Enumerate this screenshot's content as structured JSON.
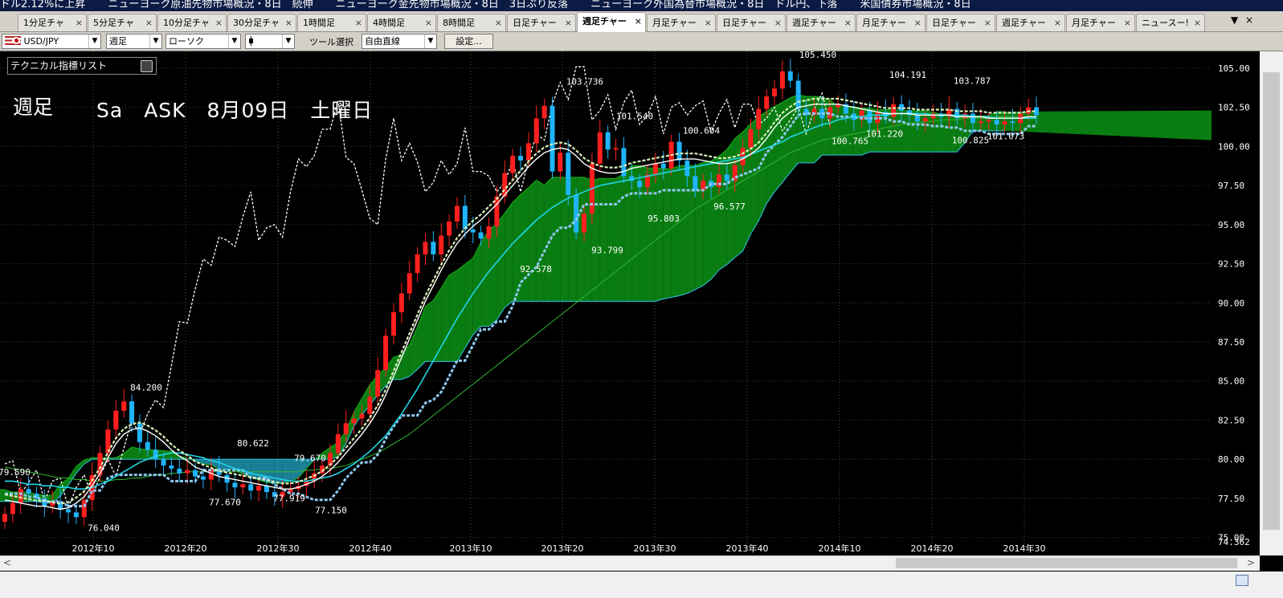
{
  "ticker": [
    "ドル2.12%に上昇",
    "ニューヨーク原油先物市場概況・8日　続伸",
    "ニューヨーク金先物市場概況・8日　3日ぶり反落",
    "ニューヨーク外国為替市場概況・8日　ドル円、下落",
    "米国債券市場概況・8日"
  ],
  "tabs": [
    {
      "label": "1分足チャ"
    },
    {
      "label": "5分足チャ"
    },
    {
      "label": "10分足チャ"
    },
    {
      "label": "30分足チャ"
    },
    {
      "label": "1時間足"
    },
    {
      "label": "4時間足"
    },
    {
      "label": "8時間足"
    },
    {
      "label": "日足チャー"
    },
    {
      "label": "週足チャー",
      "active": true
    },
    {
      "label": "月足チャー"
    },
    {
      "label": "日足チャー"
    },
    {
      "label": "週足チャー"
    },
    {
      "label": "月足チャー"
    },
    {
      "label": "日足チャー"
    },
    {
      "label": "週足チャー"
    },
    {
      "label": "月足チャー"
    },
    {
      "label": "ニュースー!"
    }
  ],
  "tab_close_glyph": "×",
  "toolbar": {
    "symbol": "USD/JPY",
    "period": "週足",
    "chart_type": "ローソク",
    "line_style": "",
    "tool_label": "ツール選択",
    "tool_value": "自由直線",
    "settings_button": "設定..."
  },
  "indicator_list": "テクニカル指標リスト",
  "title": "週足",
  "subtitle": "Sa　ASK　8月09日　土曜日",
  "chart_data": {
    "type": "candlestick",
    "y_ticks": [
      "105.00",
      "102.50",
      "100.00",
      "97.50",
      "95.00",
      "92.50",
      "90.00",
      "87.50",
      "85.00",
      "82.50",
      "80.00",
      "77.50",
      "75.00"
    ],
    "y_min_label": "74.362",
    "ylim": [
      74.362,
      106.5
    ],
    "x_ticks": [
      "2012年10",
      "2012年20",
      "2012年30",
      "2012年40",
      "2013年10",
      "2013年20",
      "2013年30",
      "2013年40",
      "2014年10",
      "2014年20",
      "2014年30"
    ],
    "annotations": [
      {
        "text": "84.200",
        "value": 84.2
      },
      {
        "text": "79.590",
        "value": 79.59
      },
      {
        "text": "76.040",
        "value": 76.04
      },
      {
        "text": "80.622",
        "value": 80.622
      },
      {
        "text": "77.670",
        "value": 77.67
      },
      {
        "text": "79.670",
        "value": 79.67
      },
      {
        "text": "77.919",
        "value": 77.919
      },
      {
        "text": "77.150",
        "value": 77.15
      },
      {
        "text": "92.578",
        "value": 92.578
      },
      {
        "text": "103.736",
        "value": 103.736
      },
      {
        "text": "93.799",
        "value": 93.799
      },
      {
        "text": "101.540",
        "value": 101.54
      },
      {
        "text": "95.803",
        "value": 95.803
      },
      {
        "text": "100.604",
        "value": 100.604
      },
      {
        "text": "96.577",
        "value": 96.577
      },
      {
        "text": "105.450",
        "value": 105.45
      },
      {
        "text": "104.191",
        "value": 104.191
      },
      {
        "text": "100.765",
        "value": 100.765
      },
      {
        "text": "101.220",
        "value": 101.22
      },
      {
        "text": "100.825",
        "value": 100.825
      },
      {
        "text": "101.073",
        "value": 101.073
      },
      {
        "text": "103.787",
        "value": 103.787
      }
    ],
    "closes": [
      76.5,
      77.2,
      78.1,
      77.8,
      77.5,
      77.0,
      77.3,
      76.8,
      76.6,
      76.3,
      77.4,
      79.0,
      80.4,
      81.9,
      83.1,
      83.7,
      82.3,
      81.1,
      80.6,
      80.0,
      79.6,
      79.4,
      79.1,
      79.3,
      78.9,
      78.7,
      79.4,
      79.0,
      78.5,
      78.2,
      78.4,
      78.0,
      78.3,
      77.9,
      77.6,
      77.9,
      78.1,
      78.3,
      78.6,
      79.1,
      79.6,
      80.4,
      81.6,
      82.3,
      82.6,
      82.9,
      84.0,
      85.7,
      87.9,
      89.4,
      90.6,
      91.9,
      93.1,
      93.9,
      93.1,
      94.3,
      95.2,
      96.2,
      94.7,
      94.5,
      94.1,
      94.9,
      96.8,
      98.3,
      99.4,
      99.1,
      100.2,
      101.8,
      102.6,
      98.4,
      99.6,
      96.9,
      94.5,
      95.7,
      98.9,
      100.9,
      99.8,
      99.9,
      98.1,
      97.8,
      97.4,
      98.2,
      98.9,
      98.6,
      100.3,
      99.1,
      98.1,
      97.2,
      97.8,
      97.4,
      98.2,
      97.8,
      98.8,
      99.9,
      101.1,
      102.4,
      103.2,
      103.7,
      104.8,
      104.2,
      102.4,
      102.0,
      102.4,
      101.8,
      102.5,
      102.7,
      102.1,
      101.7,
      102.3,
      101.5,
      102.2,
      101.9,
      102.7,
      102.3,
      102.0,
      101.6,
      101.8,
      102.1,
      101.9,
      102.4,
      101.8,
      102.1,
      101.5,
      101.6,
      101.7,
      101.4,
      101.6,
      101.5,
      102.1,
      102.5,
      102.0
    ],
    "ma_fast": [
      77.4,
      77.3,
      77.2,
      77.1,
      77.0,
      77.0,
      76.9,
      76.8,
      76.9,
      77.2,
      77.6,
      78.3,
      79.1,
      80.1,
      81.0,
      81.6,
      81.9,
      82.0,
      81.8,
      81.5,
      81.1,
      80.6,
      80.2,
      79.9,
      79.5,
      79.3,
      79.1,
      78.9,
      78.8,
      78.7,
      78.6,
      78.5,
      78.4,
      78.3,
      78.2,
      78.1,
      78.1,
      78.2,
      78.4,
      78.6,
      78.9,
      79.3,
      79.8,
      80.4,
      81.0,
      81.6,
      82.3,
      83.1,
      84.1,
      85.3,
      86.5,
      87.7,
      88.9,
      90.1,
      91.1,
      92.1,
      93.0,
      93.8,
      94.4,
      94.9,
      95.3,
      95.8,
      96.3,
      96.9,
      97.5,
      98.1,
      98.7,
      99.2,
      99.6,
      99.8,
      99.9,
      99.8,
      99.4,
      98.9,
      98.6,
      98.4,
      98.3,
      98.3,
      98.4,
      98.6,
      98.7,
      98.8,
      98.9,
      99.0,
      99.1,
      99.2,
      99.2,
      99.2,
      99.1,
      99.0,
      98.9,
      98.9,
      99.0,
      99.2,
      99.5,
      99.9,
      100.5,
      101.2,
      101.8,
      102.2,
      102.5,
      102.6,
      102.7,
      102.7,
      102.7,
      102.7,
      102.6,
      102.5,
      102.4,
      102.3,
      102.2,
      102.1,
      102.1,
      102.1,
      102.1,
      102.0,
      102.0,
      102.0,
      102.0,
      102.0,
      101.9,
      101.9,
      101.9,
      101.9,
      101.8,
      101.8,
      101.8,
      101.8,
      101.8,
      101.9,
      101.9
    ],
    "ma_mid": [
      78.6,
      78.6,
      78.5,
      78.4,
      78.4,
      78.3,
      78.3,
      78.2,
      78.2,
      78.1,
      78.1,
      78.2,
      78.4,
      78.6,
      78.9,
      79.2,
      79.5,
      79.8,
      80.0,
      80.2,
      80.3,
      80.4,
      80.4,
      80.3,
      80.2,
      80.1,
      79.9,
      79.8,
      79.6,
      79.4,
      79.3,
      79.1,
      79.0,
      78.9,
      78.8,
      78.7,
      78.6,
      78.6,
      78.6,
      78.7,
      78.8,
      78.9,
      79.1,
      79.4,
      79.7,
      80.1,
      80.5,
      81.0,
      81.5,
      82.2,
      82.9,
      83.7,
      84.5,
      85.4,
      86.3,
      87.2,
      88.1,
      89.0,
      89.8,
      90.6,
      91.3,
      92.0,
      92.6,
      93.2,
      93.8,
      94.3,
      94.8,
      95.3,
      95.7,
      96.1,
      96.4,
      96.7,
      96.9,
      97.1,
      97.3,
      97.5,
      97.6,
      97.7,
      97.8,
      97.9,
      98.0,
      98.1,
      98.2,
      98.3,
      98.4,
      98.5,
      98.6,
      98.7,
      98.8,
      98.9,
      99.0,
      99.1,
      99.2,
      99.3,
      99.5,
      99.7,
      99.9,
      100.1,
      100.3,
      100.6,
      100.8,
      101.0,
      101.2,
      101.4,
      101.5,
      101.7,
      101.8,
      101.9,
      101.9,
      102.0,
      102.0,
      102.0,
      102.1,
      102.1,
      102.1,
      102.1,
      102.1,
      102.0,
      102.0,
      102.0,
      102.0,
      102.0,
      101.9,
      101.9,
      101.9,
      101.8,
      101.8,
      101.8,
      101.8,
      101.8,
      101.8
    ],
    "ma_slow": [
      79.5,
      79.4,
      79.3,
      79.2,
      79.1,
      79.0,
      78.9,
      78.8,
      78.8,
      78.7,
      78.7,
      78.6,
      78.6,
      78.6,
      78.7,
      78.7,
      78.8,
      78.8,
      78.9,
      79.0,
      79.0,
      79.1,
      79.1,
      79.2,
      79.2,
      79.2,
      79.2,
      79.2,
      79.2,
      79.2,
      79.2,
      79.2,
      79.2,
      79.2,
      79.2,
      79.2,
      79.2,
      79.2,
      79.3,
      79.3,
      79.4,
      79.4,
      79.5,
      79.6,
      79.8,
      80.0,
      80.2,
      80.4,
      80.7,
      81.0,
      81.3,
      81.6,
      82.0,
      82.4,
      82.8,
      83.2,
      83.6,
      84.0,
      84.4,
      84.8,
      85.2,
      85.6,
      86.0,
      86.4,
      86.8,
      87.2,
      87.6,
      88.0,
      88.4,
      88.8,
      89.2,
      89.6,
      90.0,
      90.4,
      90.8,
      91.2,
      91.6,
      92.0,
      92.4,
      92.8,
      93.2,
      93.6,
      94.0,
      94.4,
      94.8,
      95.2,
      95.6,
      96.0,
      96.3,
      96.6,
      96.9,
      97.2,
      97.5,
      97.8,
      98.1,
      98.4,
      98.7,
      99.0,
      99.3,
      99.6,
      99.8,
      100.0,
      100.2,
      100.4,
      100.5,
      100.6,
      100.7,
      100.8,
      100.9,
      101.0,
      101.1,
      101.2,
      101.3,
      101.4,
      101.5,
      101.5,
      101.6,
      101.6,
      101.7,
      101.7,
      101.7,
      101.8,
      101.8,
      101.8,
      101.8,
      101.9,
      101.9,
      101.9,
      101.9,
      101.9,
      101.9
    ],
    "kijun": [
      79.0,
      79.0,
      79.0,
      78.8,
      78.8,
      78.5,
      78.5,
      78.5,
      78.2,
      78.2,
      78.2,
      79.2,
      79.2,
      80.0,
      80.2,
      80.2,
      80.2,
      80.2,
      80.2,
      80.2,
      80.2,
      79.8,
      79.8,
      79.8,
      79.8,
      80.5,
      80.5,
      80.5,
      80.5,
      80.5,
      80.5,
      80.0,
      80.0,
      80.0,
      79.6,
      79.3,
      79.0,
      79.0,
      78.8,
      78.6,
      78.6,
      78.6,
      79.2,
      80.0,
      80.5,
      81.0,
      81.0,
      81.5,
      82.5,
      83.3,
      84.0,
      84.0,
      84.0,
      84.8,
      85.0,
      85.5,
      86.5,
      87.5,
      87.5,
      88.5,
      89.5,
      89.5,
      90.0,
      90.0,
      91.0,
      92.5,
      93.0,
      93.5,
      94.5,
      95.5,
      96.0,
      96.0,
      96.5,
      97.5,
      97.5,
      97.5,
      97.5,
      97.5,
      98.0,
      98.2,
      98.2,
      98.2,
      98.2,
      98.4,
      98.4,
      98.4,
      98.4,
      98.4,
      98.4,
      98.8,
      98.8,
      98.8,
      99.2,
      99.4,
      99.6,
      99.8,
      100.8,
      101.3,
      101.8,
      102.5,
      103.2,
      103.3,
      103.3,
      103.3,
      103.3,
      103.1,
      103.1,
      103.1,
      103.0,
      103.0,
      103.0,
      103.0,
      102.8,
      102.8,
      102.6,
      102.6,
      102.6,
      102.5,
      102.5,
      102.4,
      102.4,
      102.2,
      102.2,
      102.2,
      102.0,
      102.0,
      102.0,
      102.0,
      102.0,
      102.5,
      102.5
    ]
  }
}
